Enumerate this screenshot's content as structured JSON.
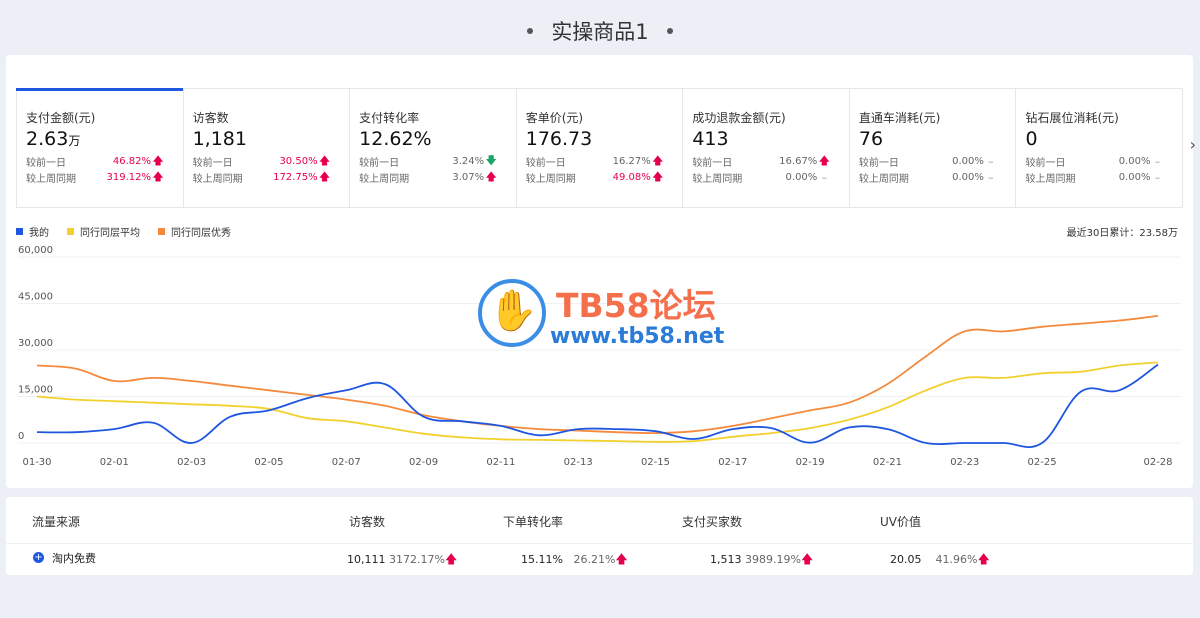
{
  "page": {
    "title": "实操商品1"
  },
  "metrics": [
    {
      "label": "支付金额(元)",
      "value": "2.63",
      "unit": "万",
      "compare": [
        {
          "label": "较前一日",
          "value": "46.82%",
          "trend": "up",
          "arrow": "🡅"
        },
        {
          "label": "较上周同期",
          "value": "319.12%",
          "trend": "up",
          "arrow": "🡅"
        }
      ]
    },
    {
      "label": "访客数",
      "value": "1,181",
      "unit": "",
      "compare": [
        {
          "label": "较前一日",
          "value": "30.50%",
          "trend": "up",
          "arrow": "🡅"
        },
        {
          "label": "较上周同期",
          "value": "172.75%",
          "trend": "up",
          "arrow": "🡅"
        }
      ]
    },
    {
      "label": "支付转化率",
      "value": "12.62%",
      "unit": "",
      "compare": [
        {
          "label": "较前一日",
          "value": "3.24%",
          "trend": "down",
          "arrow": "🡇"
        },
        {
          "label": "较上周同期",
          "value": "3.07%",
          "trend": "up",
          "arrow": "🡅"
        }
      ]
    },
    {
      "label": "客单价(元)",
      "value": "176.73",
      "unit": "",
      "compare": [
        {
          "label": "较前一日",
          "value": "16.27%",
          "trend": "up",
          "arrow": "🡅"
        },
        {
          "label": "较上周同期",
          "value": "49.08%",
          "trend": "up",
          "arrow": "🡅"
        }
      ]
    },
    {
      "label": "成功退款金额(元)",
      "value": "413",
      "unit": "",
      "compare": [
        {
          "label": "较前一日",
          "value": "16.67%",
          "trend": "up",
          "arrow": "🡅"
        },
        {
          "label": "较上周同期",
          "value": "0.00%",
          "trend": "flat",
          "arrow": "–"
        }
      ]
    },
    {
      "label": "直通车消耗(元)",
      "value": "76",
      "unit": "",
      "compare": [
        {
          "label": "较前一日",
          "value": "0.00%",
          "trend": "flat",
          "arrow": "–"
        },
        {
          "label": "较上周同期",
          "value": "0.00%",
          "trend": "flat",
          "arrow": "–"
        }
      ]
    },
    {
      "label": "钻石展位消耗(元)",
      "value": "0",
      "unit": "",
      "compare": [
        {
          "label": "较前一日",
          "value": "0.00%",
          "trend": "flat",
          "arrow": "–"
        },
        {
          "label": "较上周同期",
          "value": "0.00%",
          "trend": "flat",
          "arrow": "–"
        }
      ]
    }
  ],
  "next_icon": "chevron-right-icon",
  "chart_total": "最近30日累计：23.58万",
  "colors": {
    "primary": "#1e56e0",
    "yellow": "#f2d12e",
    "orange": "#f58a3c",
    "up": "#e5004f",
    "down": "#1aa36a"
  },
  "chart_data": {
    "type": "line",
    "x": [
      "01-30",
      "01-31",
      "02-01",
      "02-02",
      "02-03",
      "02-04",
      "02-05",
      "02-06",
      "02-07",
      "02-08",
      "02-09",
      "02-10",
      "02-11",
      "02-12",
      "02-13",
      "02-14",
      "02-15",
      "02-16",
      "02-17",
      "02-18",
      "02-19",
      "02-20",
      "02-21",
      "02-22",
      "02-23",
      "02-24",
      "02-25",
      "02-26",
      "02-27",
      "02-28"
    ],
    "x_tick_labels": [
      "01-30",
      "02-01",
      "02-03",
      "02-05",
      "02-07",
      "02-09",
      "02-11",
      "02-13",
      "02-15",
      "02-17",
      "02-19",
      "02-21",
      "02-23",
      "02-25",
      "02-28"
    ],
    "y_tick_labels": [
      "0",
      "15,000",
      "30,000",
      "45,000",
      "60,000"
    ],
    "ylim": [
      0,
      60000
    ],
    "grid": true,
    "legend_position": "top-left",
    "series": [
      {
        "name": "我的",
        "color": "#1e56e0",
        "values": [
          3500,
          3500,
          4500,
          6500,
          0,
          8500,
          10500,
          14500,
          17000,
          19000,
          8500,
          7000,
          5500,
          2500,
          4500,
          4500,
          3800,
          1300,
          4500,
          4800,
          100,
          5000,
          4500,
          0,
          0,
          0,
          0,
          16500,
          17000,
          25300
        ]
      },
      {
        "name": "同行同层平均",
        "color": "#f2d12e",
        "values": [
          15000,
          14000,
          13500,
          13000,
          12500,
          12000,
          11000,
          8000,
          7000,
          5000,
          3000,
          1800,
          1200,
          1000,
          800,
          600,
          400,
          600,
          2000,
          3200,
          4800,
          7500,
          11500,
          17000,
          21000,
          21000,
          22500,
          23000,
          25000,
          26000
        ]
      },
      {
        "name": "同行同层优秀",
        "color": "#f58a3c",
        "values": [
          25000,
          24000,
          20000,
          21000,
          20000,
          18500,
          17000,
          15500,
          14000,
          12000,
          9000,
          7000,
          5500,
          4500,
          4000,
          3500,
          3200,
          3800,
          5500,
          8000,
          10500,
          13000,
          19000,
          28000,
          36000,
          36000,
          37500,
          38500,
          39500,
          41000
        ]
      }
    ]
  },
  "watermark": {
    "title": "TB58论坛",
    "url": "www.tb58.net"
  },
  "traffic": {
    "headers": [
      "流量来源",
      "访客数",
      "下单转化率",
      "支付买家数",
      "UV价值"
    ],
    "rows": [
      {
        "icon": "plus-circle-icon",
        "source": "淘内免费",
        "visitors": "10,111",
        "visitors_pct": "3172.17%",
        "order_rate": "15.11%",
        "order_rate_pct": "26.21%",
        "buyers": "1,513",
        "buyers_pct": "3989.19%",
        "uv_value": "20.05",
        "uv_value_pct": "41.96%",
        "arrow": "🡅",
        "plus_glyph": "+"
      }
    ]
  }
}
